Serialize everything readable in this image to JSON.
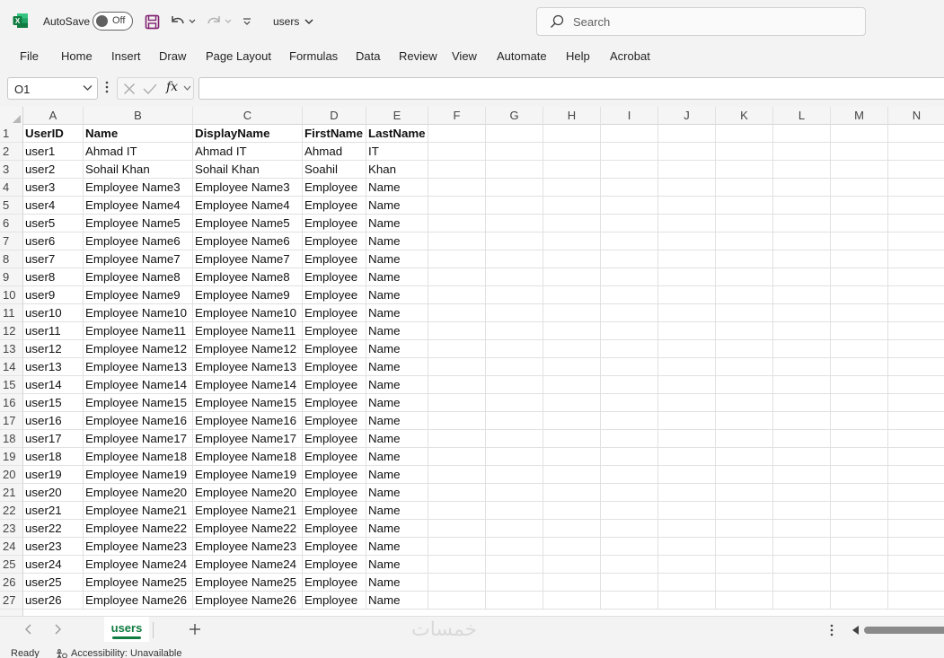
{
  "titlebar": {
    "autosave_label": "AutoSave",
    "autosave_state": "Off",
    "file_name": "users",
    "search_placeholder": "Search",
    "brand_color": "#107c41"
  },
  "menu": [
    "File",
    "Home",
    "Insert",
    "Draw",
    "Page Layout",
    "Formulas",
    "Data",
    "Review",
    "View",
    "Automate",
    "Help",
    "Acrobat"
  ],
  "formula_bar": {
    "name_box": "O1",
    "fx_label": "fx",
    "formula_value": ""
  },
  "grid": {
    "columns": [
      "A",
      "B",
      "C",
      "D",
      "E",
      "F",
      "G",
      "H",
      "I",
      "J",
      "K",
      "L",
      "M",
      "N"
    ],
    "row_numbers": [
      "1",
      "2",
      "3",
      "4",
      "5",
      "6",
      "7",
      "8",
      "9",
      "10",
      "11",
      "12",
      "13",
      "14",
      "15",
      "16",
      "17",
      "18",
      "19",
      "20",
      "21",
      "22",
      "23",
      "24",
      "25",
      "26",
      "27"
    ],
    "header": [
      "UserID",
      "Name",
      "DisplayName",
      "FirstName",
      "LastName"
    ],
    "rows": [
      [
        "user1",
        "Ahmad IT",
        "Ahmad IT",
        "Ahmad",
        "IT"
      ],
      [
        "user2",
        "Sohail Khan",
        "Sohail Khan",
        "Soahil",
        "Khan"
      ],
      [
        "user3",
        "Employee Name3",
        "Employee Name3",
        "Employee",
        "Name"
      ],
      [
        "user4",
        "Employee Name4",
        "Employee Name4",
        "Employee",
        "Name"
      ],
      [
        "user5",
        "Employee Name5",
        "Employee Name5",
        "Employee",
        "Name"
      ],
      [
        "user6",
        "Employee Name6",
        "Employee Name6",
        "Employee",
        "Name"
      ],
      [
        "user7",
        "Employee Name7",
        "Employee Name7",
        "Employee",
        "Name"
      ],
      [
        "user8",
        "Employee Name8",
        "Employee Name8",
        "Employee",
        "Name"
      ],
      [
        "user9",
        "Employee Name9",
        "Employee Name9",
        "Employee",
        "Name"
      ],
      [
        "user10",
        "Employee Name10",
        "Employee Name10",
        "Employee",
        "Name"
      ],
      [
        "user11",
        "Employee Name11",
        "Employee Name11",
        "Employee",
        "Name"
      ],
      [
        "user12",
        "Employee Name12",
        "Employee Name12",
        "Employee",
        "Name"
      ],
      [
        "user13",
        "Employee Name13",
        "Employee Name13",
        "Employee",
        "Name"
      ],
      [
        "user14",
        "Employee Name14",
        "Employee Name14",
        "Employee",
        "Name"
      ],
      [
        "user15",
        "Employee Name15",
        "Employee Name15",
        "Employee",
        "Name"
      ],
      [
        "user16",
        "Employee Name16",
        "Employee Name16",
        "Employee",
        "Name"
      ],
      [
        "user17",
        "Employee Name17",
        "Employee Name17",
        "Employee",
        "Name"
      ],
      [
        "user18",
        "Employee Name18",
        "Employee Name18",
        "Employee",
        "Name"
      ],
      [
        "user19",
        "Employee Name19",
        "Employee Name19",
        "Employee",
        "Name"
      ],
      [
        "user20",
        "Employee Name20",
        "Employee Name20",
        "Employee",
        "Name"
      ],
      [
        "user21",
        "Employee Name21",
        "Employee Name21",
        "Employee",
        "Name"
      ],
      [
        "user22",
        "Employee Name22",
        "Employee Name22",
        "Employee",
        "Name"
      ],
      [
        "user23",
        "Employee Name23",
        "Employee Name23",
        "Employee",
        "Name"
      ],
      [
        "user24",
        "Employee Name24",
        "Employee Name24",
        "Employee",
        "Name"
      ],
      [
        "user25",
        "Employee Name25",
        "Employee Name25",
        "Employee",
        "Name"
      ],
      [
        "user26",
        "Employee Name26",
        "Employee Name26",
        "Employee",
        "Name"
      ]
    ]
  },
  "sheet_tabs": {
    "active": "users",
    "watermark": "خمسات"
  },
  "status": {
    "ready": "Ready",
    "accessibility": "Accessibility: Unavailable"
  },
  "icons": [
    "excel-logo-icon",
    "save-icon",
    "undo-icon",
    "redo-icon",
    "customize-qat-icon",
    "search-icon",
    "chevron-down-icon",
    "cancel-icon",
    "enter-icon",
    "more-icon",
    "prev-sheet-icon",
    "next-sheet-icon",
    "add-sheet-icon",
    "accessibility-icon"
  ]
}
